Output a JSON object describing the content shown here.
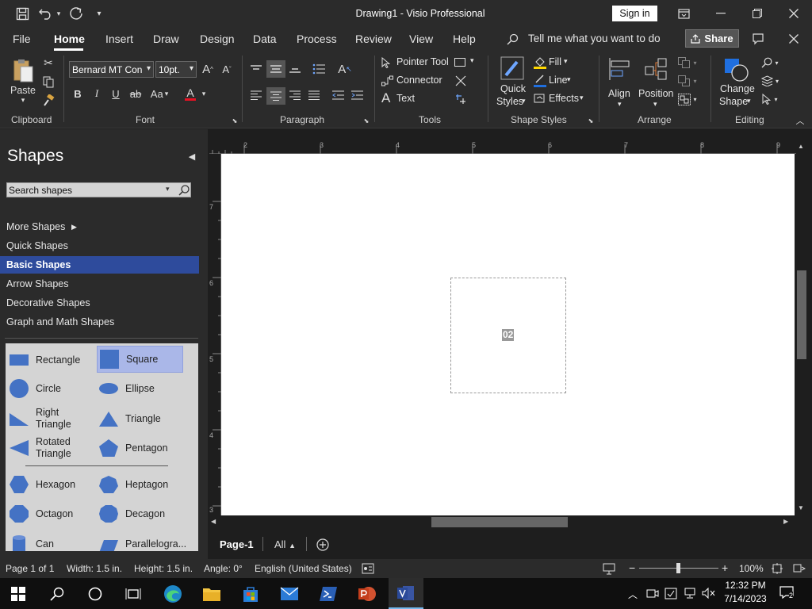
{
  "titlebar": {
    "title": "Drawing1  -  Visio Professional",
    "sign_in": "Sign in"
  },
  "menu": {
    "items": [
      "File",
      "Home",
      "Insert",
      "Draw",
      "Design",
      "Data",
      "Process",
      "Review",
      "View",
      "Help"
    ],
    "active": "Home",
    "tell_me": "Tell me what you want to do",
    "share": "Share"
  },
  "ribbon": {
    "clipboard": {
      "paste": "Paste",
      "label": "Clipboard"
    },
    "font": {
      "family": "Bernard MT Conc",
      "size": "10pt.",
      "label": "Font",
      "bold": "B",
      "italic": "I",
      "underline": "U",
      "strike": "ab",
      "case": "Aa",
      "color_glyph": "A",
      "grow": "A",
      "shrink": "A"
    },
    "paragraph": {
      "label": "Paragraph"
    },
    "tools": {
      "pointer": "Pointer Tool",
      "connector": "Connector",
      "text": "Text",
      "label": "Tools"
    },
    "shape_styles": {
      "quick_styles_1": "Quick",
      "quick_styles_2": "Styles",
      "fill": "Fill",
      "line": "Line",
      "effects": "Effects",
      "label": "Shape Styles"
    },
    "arrange": {
      "align": "Align",
      "position": "Position",
      "label": "Arrange"
    },
    "editing": {
      "change_shape_1": "Change",
      "change_shape_2": "Shape",
      "label": "Editing"
    }
  },
  "shapes_pane": {
    "title": "Shapes",
    "search_placeholder": "Search shapes",
    "stencils": [
      "More Shapes",
      "Quick Shapes",
      "Basic Shapes",
      "Arrow Shapes",
      "Decorative Shapes",
      "Graph and Math Shapes"
    ],
    "selected_stencil": "Basic Shapes",
    "shapes": [
      {
        "name": "Rectangle",
        "icon": "rectangle-icon"
      },
      {
        "name": "Square",
        "icon": "square-icon"
      },
      {
        "name": "Circle",
        "icon": "circle-icon"
      },
      {
        "name": "Ellipse",
        "icon": "ellipse-icon"
      },
      {
        "name": "Right Triangle",
        "icon": "right-triangle-icon"
      },
      {
        "name": "Triangle",
        "icon": "triangle-icon"
      },
      {
        "name": "Rotated Triangle",
        "icon": "rotated-triangle-icon"
      },
      {
        "name": "Pentagon",
        "icon": "pentagon-icon"
      },
      {
        "name": "Hexagon",
        "icon": "hexagon-icon"
      },
      {
        "name": "Heptagon",
        "icon": "heptagon-icon"
      },
      {
        "name": "Octagon",
        "icon": "octagon-icon"
      },
      {
        "name": "Decagon",
        "icon": "decagon-icon"
      },
      {
        "name": "Can",
        "icon": "can-icon"
      },
      {
        "name": "Parallelogra...",
        "icon": "parallelogram-icon"
      }
    ],
    "selected_shape": "Square"
  },
  "canvas": {
    "shape_text": "02",
    "ruler_h": [
      "2",
      "3",
      "4",
      "5",
      "6",
      "7",
      "8",
      "9"
    ],
    "ruler_v": [
      "7",
      "6",
      "5",
      "4",
      "3"
    ]
  },
  "pages": {
    "current": "Page-1",
    "all": "All"
  },
  "status": {
    "page": "Page 1 of 1",
    "width": "Width: 1.5 in.",
    "height": "Height: 1.5 in.",
    "angle": "Angle: 0°",
    "language": "English (United States)",
    "zoom": "100%"
  },
  "taskbar": {
    "time": "12:32 PM",
    "date": "7/14/2023",
    "notification_count": "2"
  },
  "colors": {
    "accent_selected": "#2e4b9c",
    "shape_blue": "#4472c4",
    "ribbon_bg": "#2b2b2b"
  }
}
